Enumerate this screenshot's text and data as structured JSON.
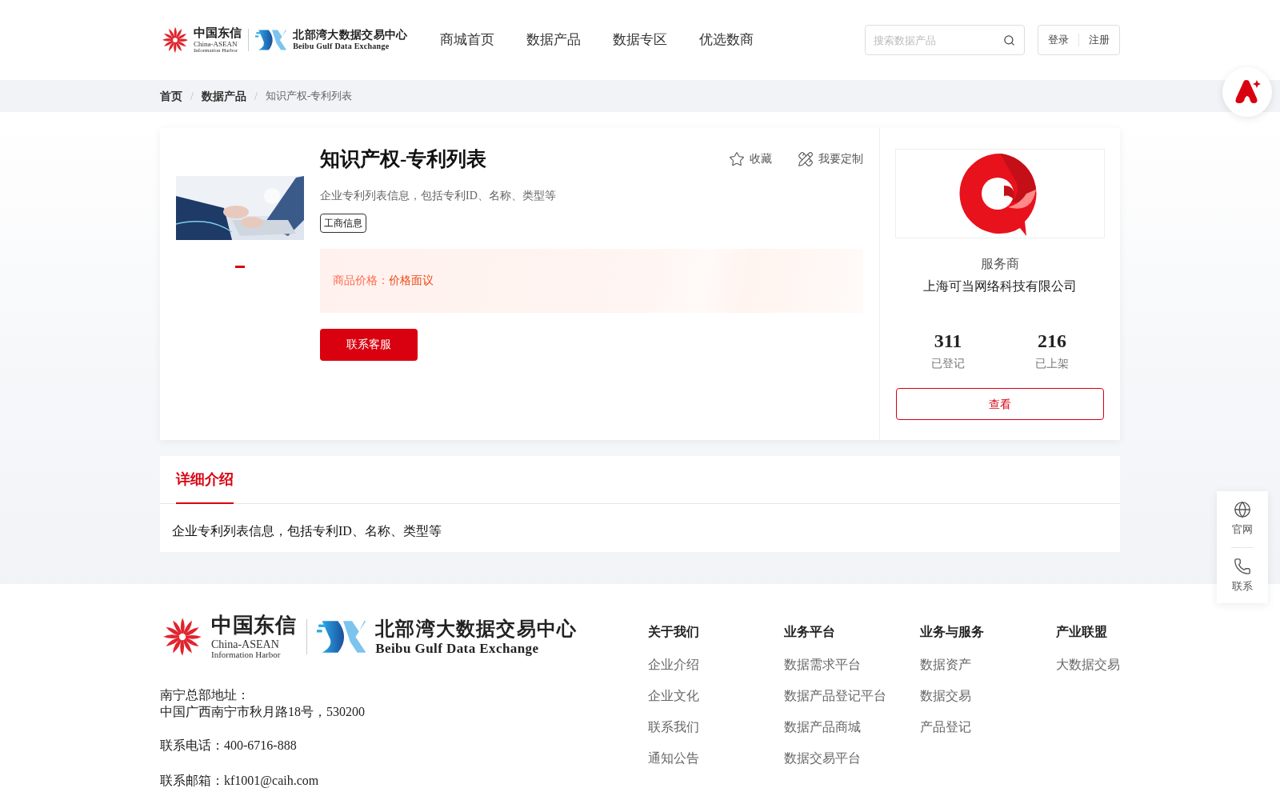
{
  "header": {
    "brand_left": {
      "name": "中国东信",
      "sub1": "China-ASEAN",
      "sub2": "Information Harbor"
    },
    "brand_right": {
      "name": "北部湾大数据交易中心",
      "sub": "Beibu Gulf Data Exchange"
    },
    "nav": [
      "商城首页",
      "数据产品",
      "数据专区",
      "优选数商"
    ],
    "search": {
      "placeholder": "搜索数据产品"
    },
    "auth": [
      "登录",
      "注册"
    ]
  },
  "breadcrumb_separator": "/",
  "breadcrumb": [
    {
      "label": "首页",
      "current": false
    },
    {
      "label": "数据产品",
      "current": false
    },
    {
      "label": "知识产权-专利列表",
      "current": true
    }
  ],
  "product": {
    "title": "知识产权-专利列表",
    "actions": [
      "收藏",
      "我要定制"
    ],
    "description": "企业专利列表信息，包括专利ID、名称、类型等",
    "tag": "工商信息",
    "price_label": "商品价格：",
    "price_value": "价格面议",
    "contact_button": "联系客服",
    "image": {
      "kind": "picture"
    }
  },
  "provider": {
    "role": "服务商",
    "name": "上海可当网络科技有限公司",
    "stats": [
      {
        "value": "311",
        "label": "已登记"
      },
      {
        "value": "216",
        "label": "已上架"
      }
    ],
    "view_button": "查看"
  },
  "details": {
    "tabs": [
      {
        "label": "详细介绍",
        "selected": true
      }
    ],
    "text": "企业专利列表信息，包括专利ID、名称、类型等"
  },
  "footer": {
    "brand_left": {
      "name": "中国东信",
      "sub1": "China-ASEAN",
      "sub2": "Information Harbor"
    },
    "brand_right": {
      "name": "北部湾大数据交易中心",
      "sub": "Beibu Gulf Data Exchange"
    },
    "address_label": "南宁总部地址：",
    "address": "中国广西南宁市秋月路18号，530200",
    "phone": "联系电话：400-6716-888",
    "email": "联系邮箱：kf1001@caih.com",
    "columns": [
      {
        "heading": "关于我们",
        "links": [
          "企业介绍",
          "企业文化",
          "联系我们",
          "通知公告"
        ]
      },
      {
        "heading": "业务平台",
        "links": [
          "数据需求平台",
          "数据产品登记平台",
          "数据产品商城",
          "数据交易平台"
        ]
      },
      {
        "heading": "业务与服务",
        "links": [
          "数据资产",
          "数据交易",
          "产品登记"
        ]
      },
      {
        "heading": "产业联盟",
        "links": [
          "大数据交易"
        ]
      }
    ]
  },
  "side_panel": [
    "官网",
    "联系"
  ]
}
